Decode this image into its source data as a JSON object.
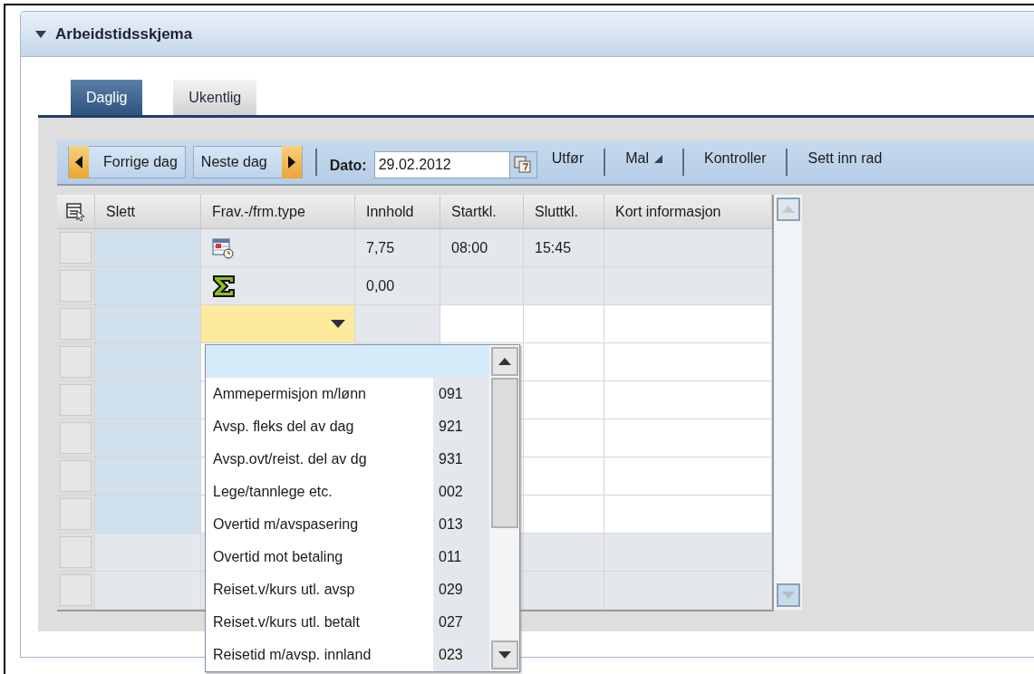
{
  "panel": {
    "title": "Arbeidstidsskjema",
    "expanded": true
  },
  "tabs": [
    {
      "label": "Daglig",
      "selected": true
    },
    {
      "label": "Ukentlig",
      "selected": false
    }
  ],
  "toolbar": {
    "prev_button": "Forrige dag",
    "next_button": "Neste dag",
    "date_label": "Dato:",
    "date_value": "29.02.2012",
    "actions": [
      {
        "label": "Utfør",
        "kind": "button"
      },
      {
        "label": "Mal",
        "kind": "menu"
      },
      {
        "label": "Kontroller",
        "kind": "button"
      },
      {
        "label": "Sett inn rad",
        "kind": "button"
      }
    ]
  },
  "table": {
    "columns": [
      "Slett",
      "Frav.-/frm.type",
      "Innhold",
      "Startkl.",
      "Sluttkl.",
      "Kort informasjon"
    ],
    "rows": [
      {
        "kind": "entry",
        "type_cell": {
          "kind": "calendar-clock"
        },
        "innhold": "7,75",
        "startkl": "08:00",
        "sluttkl": "15:45",
        "focused": false
      },
      {
        "kind": "entry",
        "type_cell": {
          "kind": "sum"
        },
        "innhold": "0,00",
        "focused": false
      },
      {
        "kind": "input",
        "focused": true
      },
      {
        "kind": "input",
        "focused": false
      },
      {
        "kind": "input",
        "focused": false
      },
      {
        "kind": "input",
        "focused": false
      },
      {
        "kind": "input",
        "focused": false
      },
      {
        "kind": "input",
        "focused": false
      },
      {
        "kind": "blank",
        "focused": false
      },
      {
        "kind": "blank",
        "focused": false
      }
    ],
    "dropdown": {
      "items": [
        {
          "label": "Ammepermisjon m/lønn",
          "code": "091"
        },
        {
          "label": "Avsp. fleks del av dag",
          "code": "921"
        },
        {
          "label": "Avsp.ovt/reist. del av dg",
          "code": "931"
        },
        {
          "label": "Lege/tannlege etc.",
          "code": "002"
        },
        {
          "label": "Overtid m/avspasering",
          "code": "013"
        },
        {
          "label": "Overtid mot betaling",
          "code": "011"
        },
        {
          "label": "Reiset.v/kurs utl. avsp",
          "code": "029"
        },
        {
          "label": "Reiset.v/kurs utl. betalt",
          "code": "027"
        },
        {
          "label": "Reisetid m/avsp. innland",
          "code": "023"
        }
      ]
    }
  }
}
